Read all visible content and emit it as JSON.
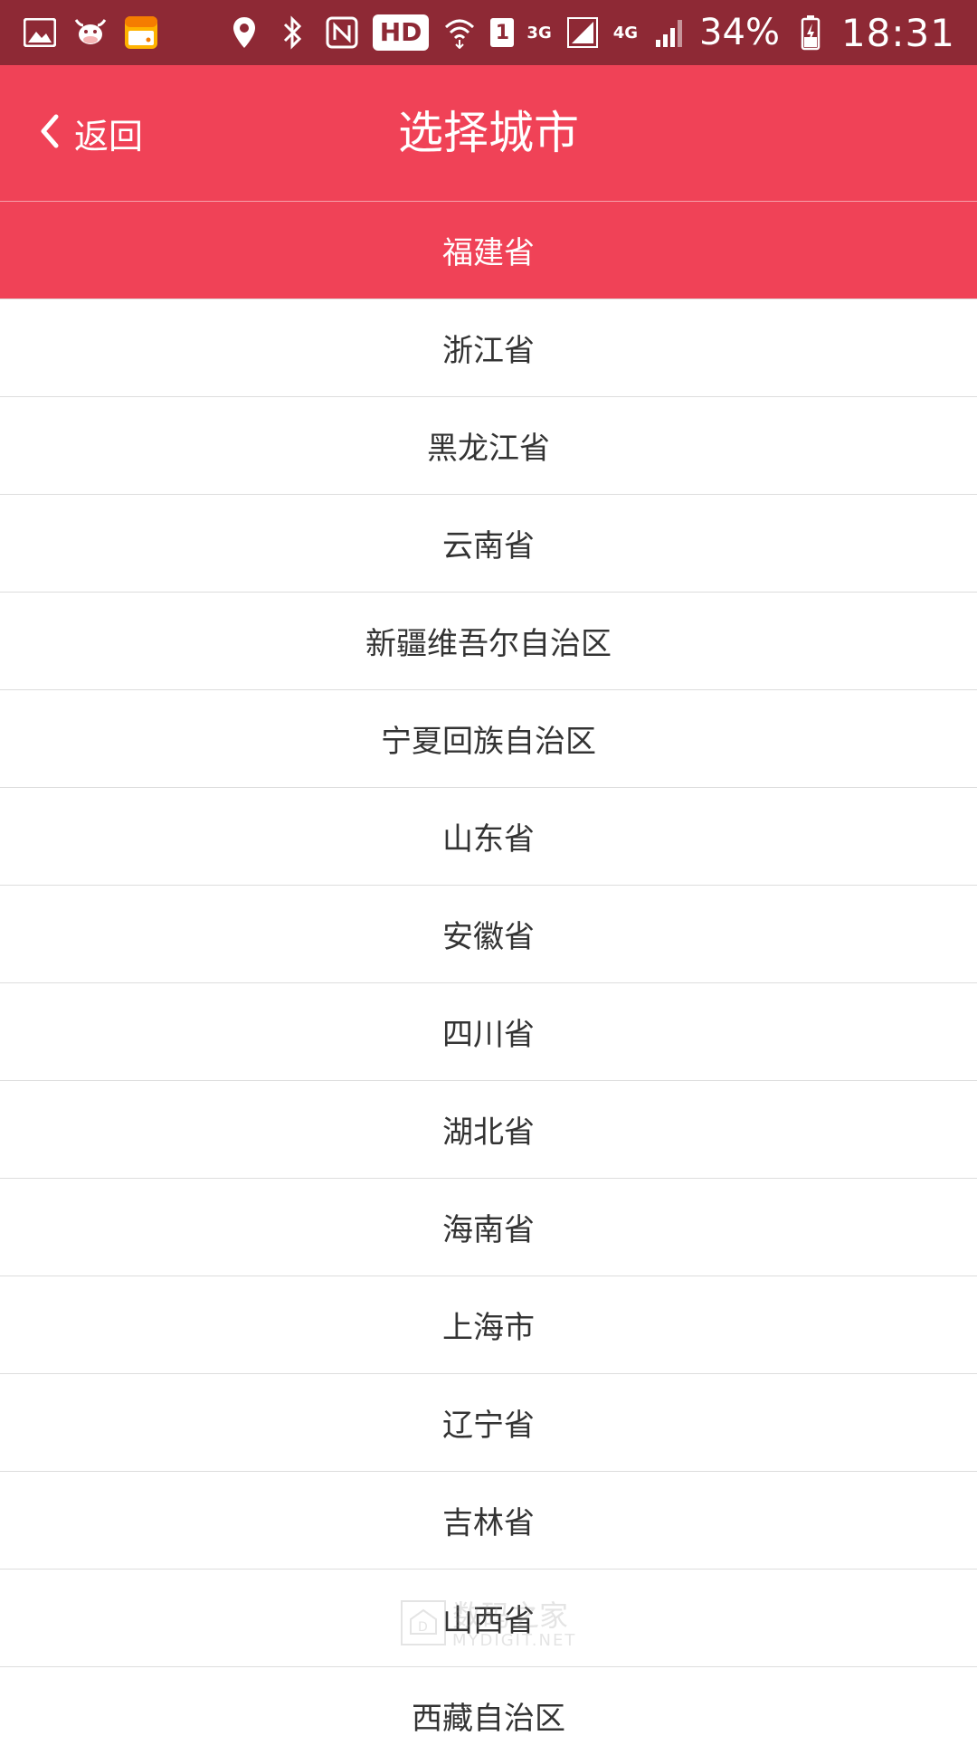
{
  "status_bar": {
    "hd_label": "HD",
    "sim_slot": "1",
    "net_3g": "3G",
    "net_4g": "4G",
    "battery_percent": "34%",
    "time": "18:31",
    "left_icons": [
      "gallery-icon",
      "cow-app-icon",
      "wallet-app-icon"
    ],
    "right_icons": [
      "location-icon",
      "bluetooth-icon",
      "nfc-icon",
      "wifi-icon",
      "signal-icon",
      "battery-icon"
    ]
  },
  "header": {
    "back_label": "返回",
    "title": "选择城市"
  },
  "provinces": {
    "selected": "福建省",
    "items": [
      "福建省",
      "浙江省",
      "黑龙江省",
      "云南省",
      "新疆维吾尔自治区",
      "宁夏回族自治区",
      "山东省",
      "安徽省",
      "四川省",
      "湖北省",
      "海南省",
      "上海市",
      "辽宁省",
      "吉林省",
      "山西省",
      "西藏自治区"
    ]
  },
  "watermark": {
    "text": "数码之家",
    "sub": "MYDIGIT.NET"
  },
  "colors": {
    "status_bar": "#8e2935",
    "accent": "#f04257",
    "list_text": "#333333",
    "divider": "#dddddd"
  }
}
